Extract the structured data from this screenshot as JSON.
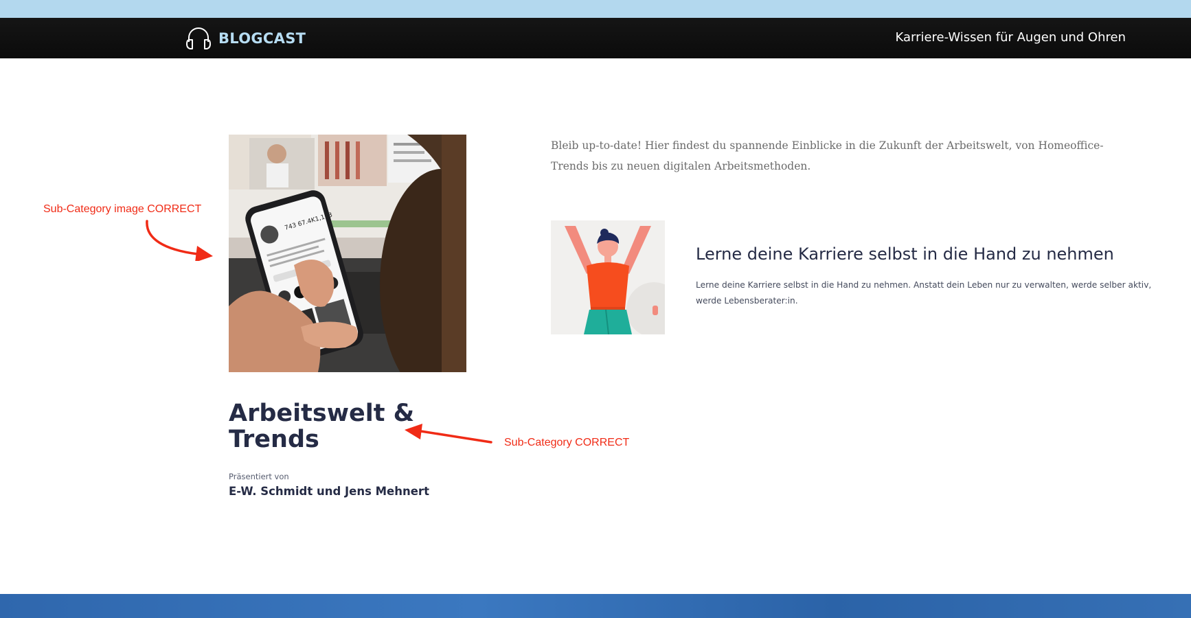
{
  "header": {
    "logo_text": "BLOGCAST",
    "logo_icon": "headphones-icon",
    "tagline": "Karriere-Wissen für Augen und Ohren"
  },
  "annotations": {
    "image_note": "Sub-Category image CORRECT",
    "title_note": "Sub-Category CORRECT"
  },
  "category": {
    "title": "Arbeitswelt & Trends",
    "presented_label": "Präsentiert von",
    "presenters": "E-W. Schmidt und Jens Mehnert",
    "intro": "Bleib up-to-date! Hier findest du spannende Einblicke in die Zukunft der Arbeitswelt, von Homeoffice-Trends bis zu neuen digitalen Arbeitsmethoden."
  },
  "post": {
    "title": "Lerne deine Karriere selbst in die Hand zu nehmen",
    "excerpt": "Lerne deine Karriere selbst in die Hand zu nehmen. Anstatt dein Leben nur zu verwalten, werde selber aktiv, werde Lebensberater:in."
  },
  "colors": {
    "accent_blue": "#b3d8ee",
    "header_bg": "#0f0f0f",
    "title_navy": "#252b45",
    "annotation_red": "#f02b16",
    "footer_blue": "#3670b5"
  }
}
